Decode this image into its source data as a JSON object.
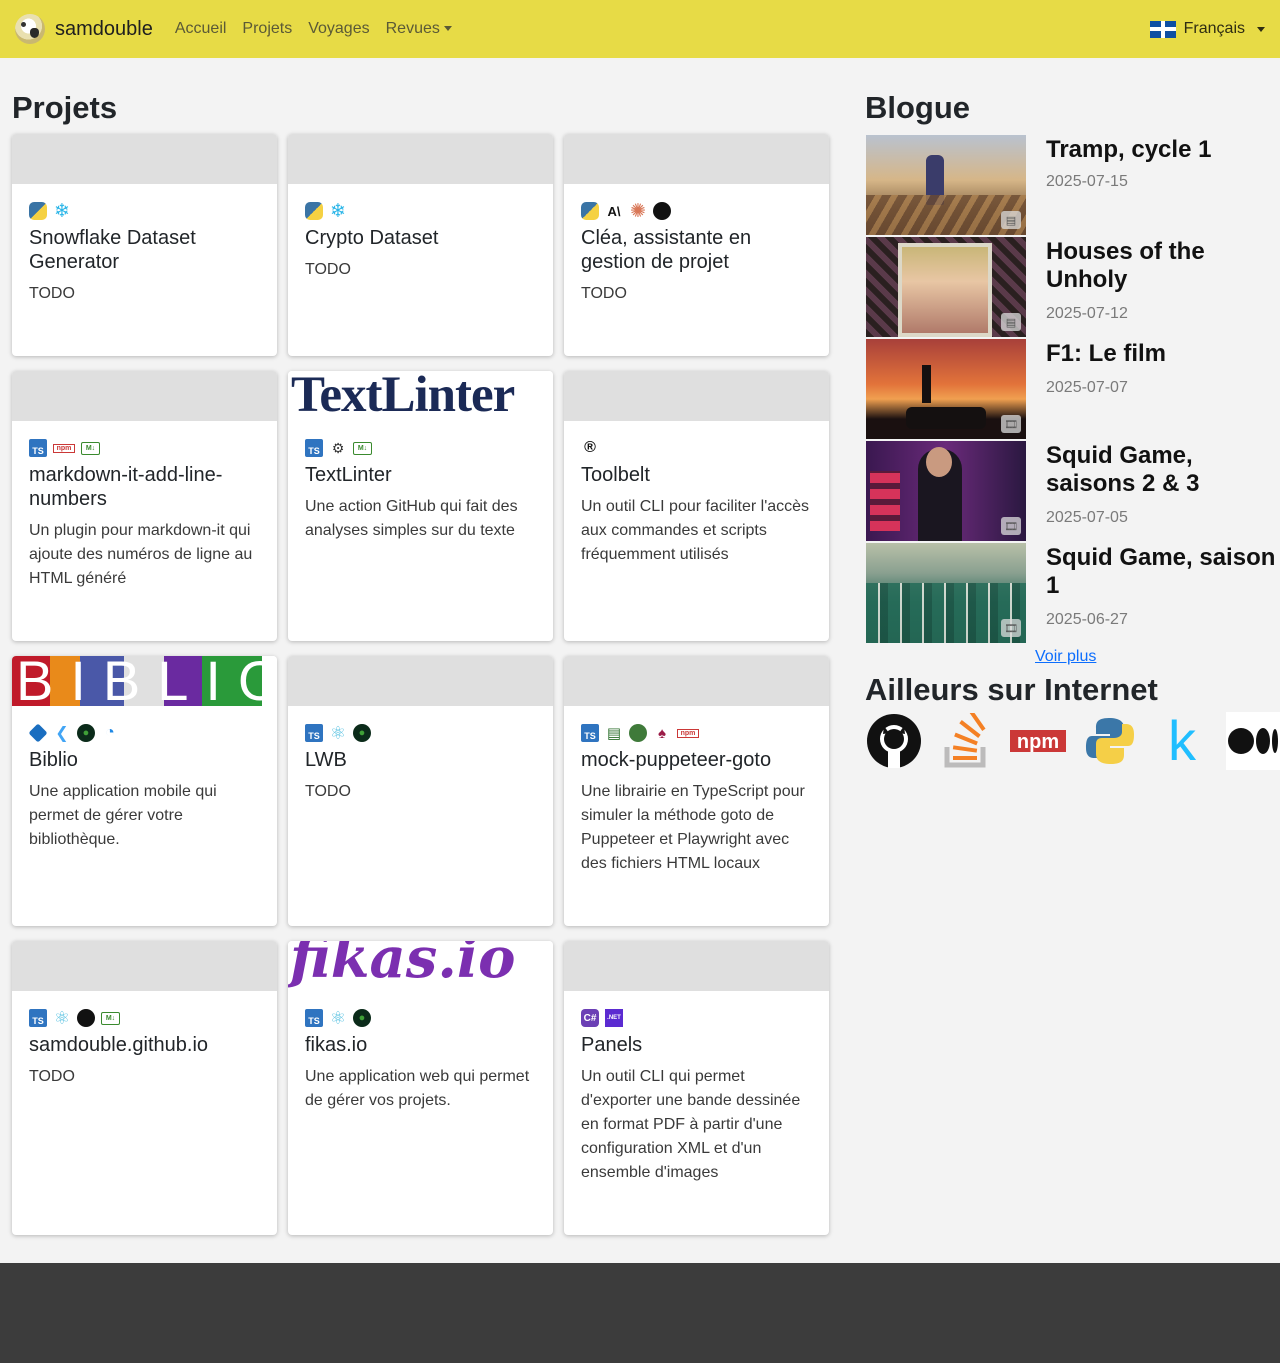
{
  "navbar": {
    "brand": "samdouble",
    "links": [
      "Accueil",
      "Projets",
      "Voyages",
      "Revues"
    ],
    "language": "Français"
  },
  "projects_section": {
    "title": "Projets",
    "cards": [
      {
        "title": "Snowflake Dataset Generator",
        "description": "TODO",
        "tech": [
          "python-icon",
          "snowflake-icon"
        ]
      },
      {
        "title": "Crypto Dataset",
        "description": "TODO",
        "tech": [
          "python-icon",
          "snowflake-icon"
        ]
      },
      {
        "title": "Cléa, assistante en gestion de projet",
        "description": "TODO",
        "tech": [
          "python-icon",
          "anthropic-icon",
          "claude-icon",
          "linear-icon"
        ]
      },
      {
        "title": "markdown-it-add-line-numbers",
        "description": "Un plugin pour markdown-it qui ajoute des numéros de ligne au HTML généré",
        "tech": [
          "typescript-icon",
          "npm-icon",
          "markdown-icon"
        ]
      },
      {
        "title": "TextLinter",
        "description": "Une action GitHub qui fait des analyses simples sur du texte",
        "tech": [
          "typescript-icon",
          "workflow-icon",
          "markdown-icon"
        ],
        "thumb_text": "TextLinter"
      },
      {
        "title": "Toolbelt",
        "description": "Un outil CLI pour faciliter l'accès aux commandes et scripts fréquemment utilisés",
        "tech": [
          "rust-icon"
        ]
      },
      {
        "title": "Biblio",
        "description": "Une application mobile qui permet de gérer votre bibliothèque.",
        "tech": [
          "cube-icon",
          "flutter-icon",
          "mongodb-icon",
          "digitalocean-icon"
        ],
        "thumb_text": "BIBLIO"
      },
      {
        "title": "LWB",
        "description": "TODO",
        "tech": [
          "typescript-icon",
          "react-icon",
          "mongodb-icon"
        ]
      },
      {
        "title": "mock-puppeteer-goto",
        "description": "Une librairie en TypeScript pour simuler la méthode goto de Puppeteer et Playwright avec des fichiers HTML locaux",
        "tech": [
          "typescript-icon",
          "jar-icon",
          "puppeteer-icon",
          "jest-icon",
          "npm-icon"
        ]
      },
      {
        "title": "samdouble.github.io",
        "description": "TODO",
        "tech": [
          "typescript-icon",
          "react-icon",
          "github-icon",
          "markdown-icon"
        ]
      },
      {
        "title": "fikas.io",
        "description": "Une application web qui permet de gérer vos projets.",
        "tech": [
          "typescript-icon",
          "react-icon",
          "mongodb-icon"
        ],
        "thumb_text": "fikas.io"
      },
      {
        "title": "Panels",
        "description": "Un outil CLI qui permet d'exporter une bande dessinée en format PDF à partir d'une configuration XML et d'un ensemble d'images",
        "tech": [
          "csharp-icon",
          "dotnet-icon"
        ]
      }
    ]
  },
  "blog_section": {
    "title": "Blogue",
    "posts": [
      {
        "title": "Tramp, cycle 1",
        "date": "2025-07-15"
      },
      {
        "title": "Houses of the Unholy",
        "date": "2025-07-12"
      },
      {
        "title": "F1: Le film",
        "date": "2025-07-07"
      },
      {
        "title": "Squid Game, saisons 2 & 3",
        "date": "2025-07-05"
      },
      {
        "title": "Squid Game, saison 1",
        "date": "2025-06-27"
      }
    ],
    "more_link": "Voir plus"
  },
  "elsewhere_section": {
    "title": "Ailleurs sur Internet",
    "links": [
      "github-icon",
      "stackoverflow-icon",
      "npm-icon",
      "python-icon",
      "kaggle-icon",
      "medium-icon"
    ]
  },
  "tech_labels": {
    "ts": "TS",
    "npm": "npm",
    "md": "M↓",
    "dotnet": ".NET",
    "csharp": "C#"
  },
  "colors": {
    "navbar_bg": "#e7db46",
    "page_bg": "#f3f3f3",
    "footer_bg": "#3c3c3c",
    "link": "#0d6efd"
  }
}
